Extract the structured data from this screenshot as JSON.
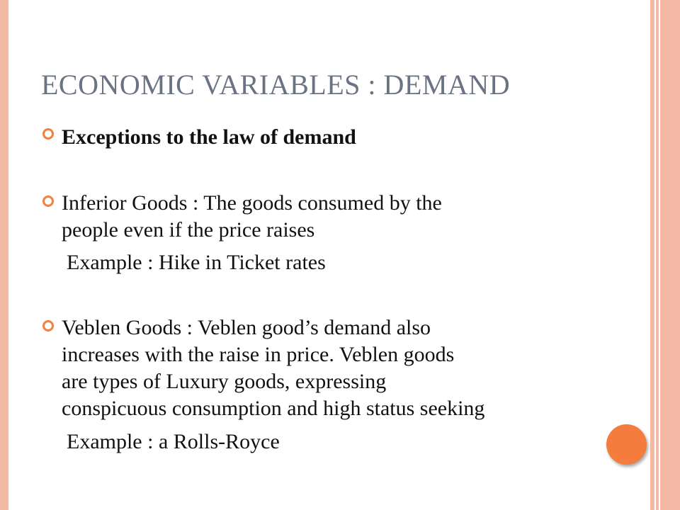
{
  "slide": {
    "title": "ECONOMIC VARIABLES : DEMAND",
    "bullets": [
      {
        "lines": [
          "Exceptions to the law of demand"
        ]
      },
      {
        "lines": [
          "Inferior Goods : The goods consumed by the",
          "people even if the price raises"
        ],
        "example": "Example : Hike in Ticket rates"
      },
      {
        "lines": [
          "Veblen Goods : Veblen good’s demand also",
          "increases with the raise in price.  Veblen goods",
          "are types of Luxury goods, expressing",
          "conspicuous consumption and high status seeking"
        ],
        "example": "Example : a Rolls-Royce"
      }
    ]
  },
  "colors": {
    "accent": "#f2803f",
    "border": "#f4b9a4",
    "title": "#6a7383"
  }
}
